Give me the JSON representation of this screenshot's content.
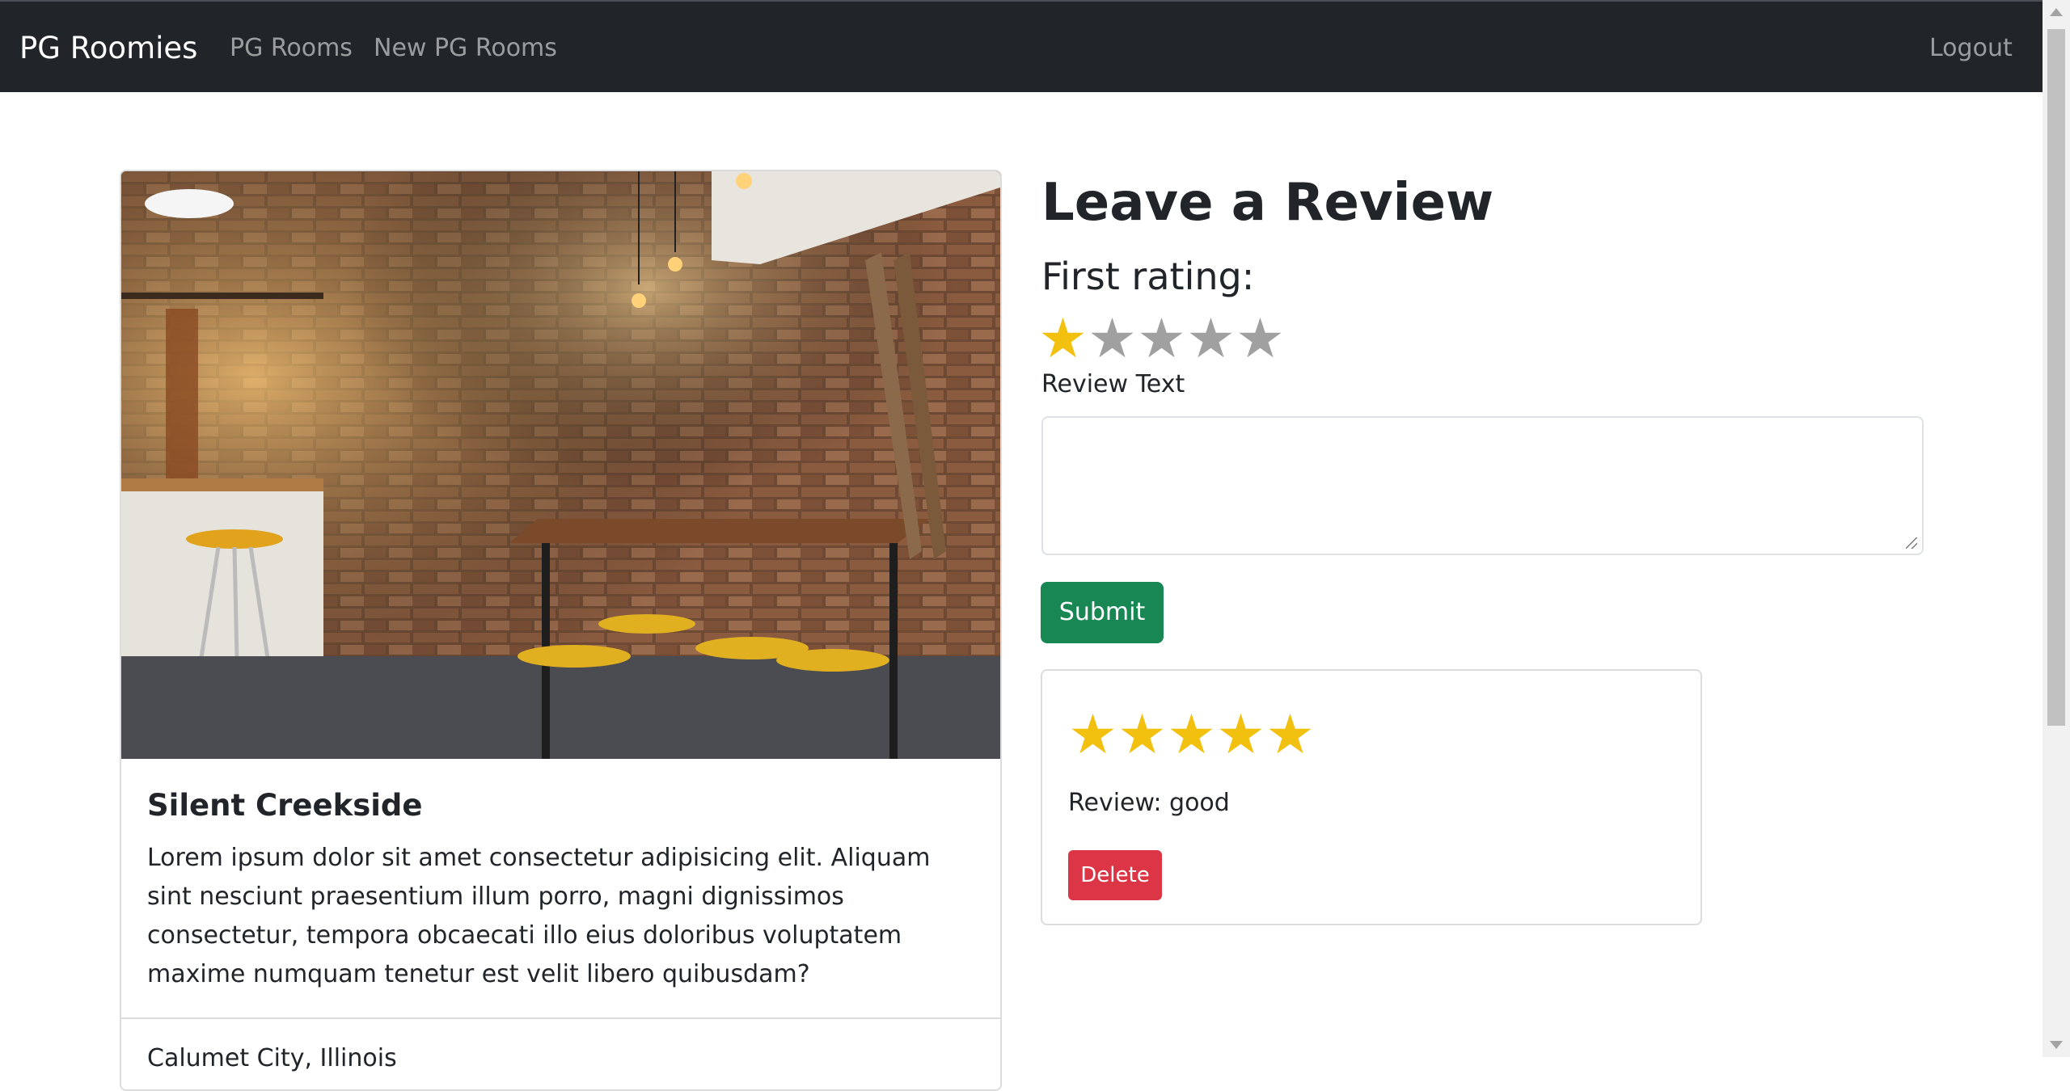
{
  "navbar": {
    "brand": "PG Roomies",
    "links": [
      "PG Rooms",
      "New PG Rooms"
    ],
    "logout": "Logout"
  },
  "room": {
    "title": "Silent Creekside",
    "description": "Lorem ipsum dolor sit amet consectetur adipisicing elit. Aliquam sint nesciunt praesentium illum porro, magni dignissimos consectetur, tempora obcaecati illo eius doloribus voluptatem maxime numquam tenetur est velit libero quibusdam?",
    "location": "Calumet City, Illinois",
    "photo_icon": "room-photo"
  },
  "review_form": {
    "heading": "Leave a Review",
    "rating_label": "First rating:",
    "rating_value": 1,
    "rating_max": 5,
    "text_label": "Review Text",
    "text_value": "",
    "submit_label": "Submit"
  },
  "reviews": [
    {
      "rating": 5,
      "rating_max": 5,
      "text": "Review: good",
      "delete_label": "Delete"
    }
  ],
  "colors": {
    "navbar": "#212529",
    "star_on": "#f2c00e",
    "star_off": "#a0a0a0",
    "submit": "#198754",
    "delete": "#dc3545"
  }
}
